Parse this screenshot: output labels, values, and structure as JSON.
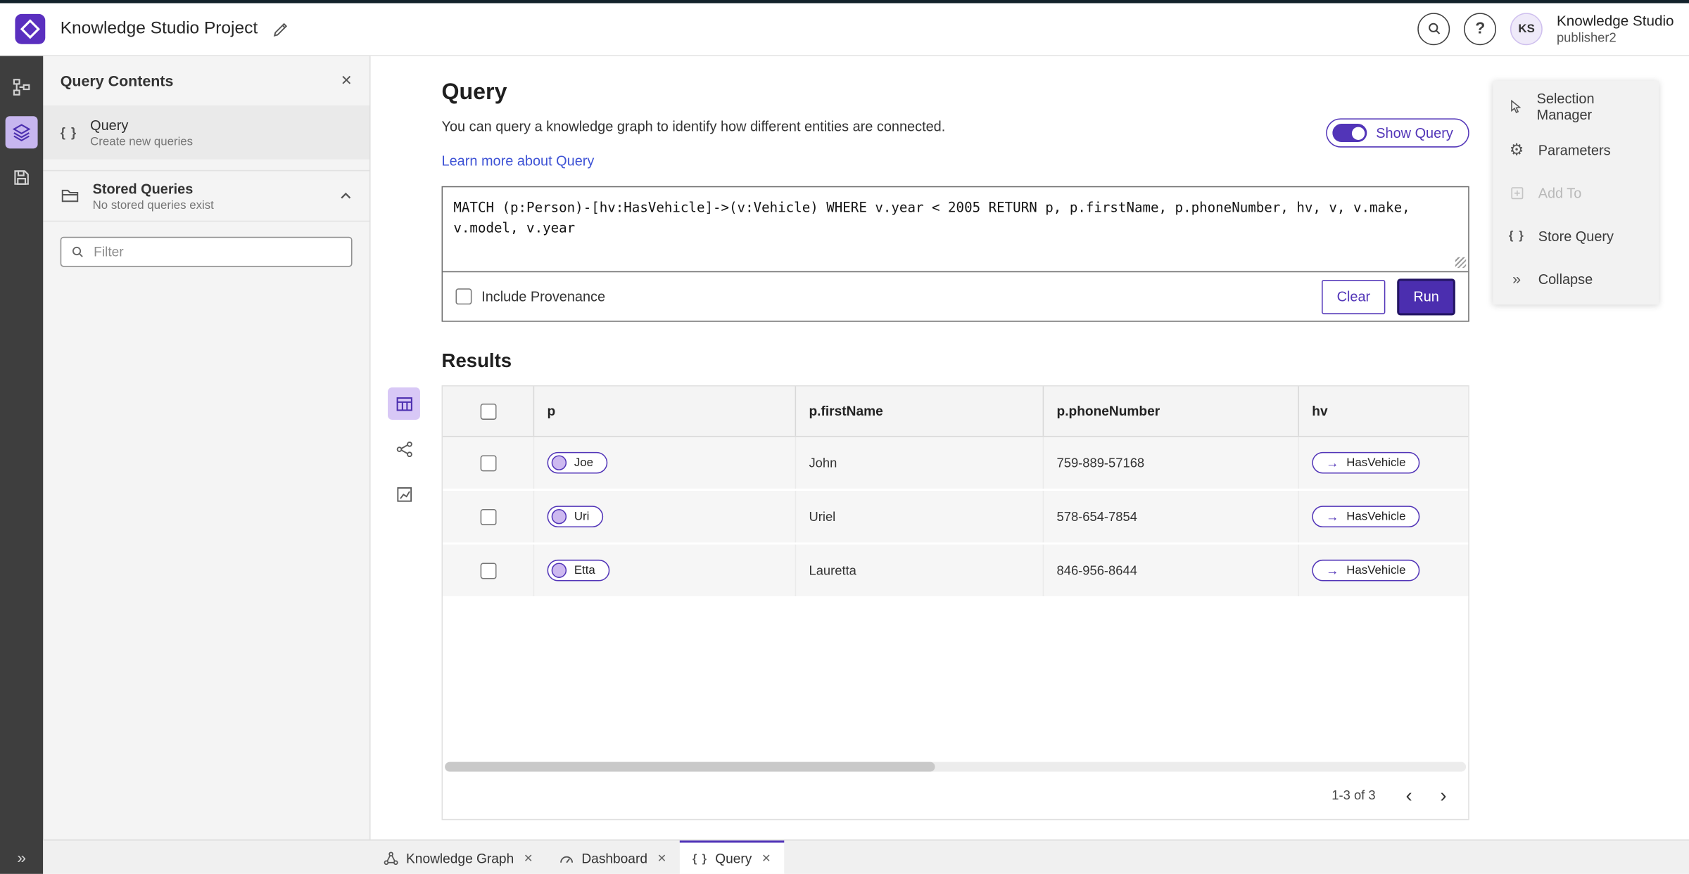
{
  "header": {
    "title": "Knowledge Studio Project",
    "user": {
      "initials": "KS",
      "name": "Knowledge Studio",
      "role": "publisher2"
    }
  },
  "left_panel": {
    "title": "Query Contents",
    "query_item": {
      "label": "Query",
      "description": "Create new queries"
    },
    "stored_queries": {
      "label": "Stored Queries",
      "description": "No stored queries exist"
    },
    "filter": {
      "placeholder": "Filter"
    }
  },
  "main": {
    "title": "Query",
    "description": "You can query a knowledge graph to identify how different entities are connected.",
    "learn_more_link": "Learn more about Query",
    "show_query_toggle": {
      "label": "Show Query",
      "state": "on"
    },
    "query_editor": {
      "text": "MATCH (p:Person)-[hv:HasVehicle]->(v:Vehicle) WHERE v.year < 2005 RETURN p, p.firstName, p.phoneNumber, hv, v, v.make, v.model, v.year"
    },
    "include_provenance": {
      "label": "Include Provenance",
      "checked": false
    },
    "buttons": {
      "clear": "Clear",
      "run": "Run"
    },
    "results_title": "Results"
  },
  "results_table": {
    "columns": [
      "p",
      "p.firstName",
      "p.phoneNumber",
      "hv"
    ],
    "rows": [
      {
        "p_node": "Joe",
        "firstName": "John",
        "phoneNumber": "759-889-57168",
        "hv_edge": "HasVehicle"
      },
      {
        "p_node": "Uri",
        "firstName": "Uriel",
        "phoneNumber": "578-654-7854",
        "hv_edge": "HasVehicle"
      },
      {
        "p_node": "Etta",
        "firstName": "Lauretta",
        "phoneNumber": "846-956-8644",
        "hv_edge": "HasVehicle"
      }
    ],
    "pagination": {
      "range_label": "1-3 of 3"
    }
  },
  "right_panel": {
    "items": [
      {
        "label": "Selection Manager",
        "disabled": false
      },
      {
        "label": "Parameters",
        "disabled": false
      },
      {
        "label": "Add To",
        "disabled": true
      },
      {
        "label": "Store Query",
        "disabled": false
      },
      {
        "label": "Collapse",
        "disabled": false
      }
    ]
  },
  "bottom_tabs": [
    {
      "label": "Knowledge Graph",
      "active": false
    },
    {
      "label": "Dashboard",
      "active": false
    },
    {
      "label": "Query",
      "active": true
    }
  ],
  "glyphs": {
    "braces": "{ }",
    "close": "✕",
    "double_chevron_right": "»",
    "arrow_right": "→",
    "question_mark": "?",
    "chevron_left": "‹",
    "chevron_right": "›",
    "gear": "⚙"
  },
  "colors": {
    "accent": "#5235b8",
    "accent_dark": "#4b2eaf",
    "link": "#3d52d5",
    "rail_bg": "#3e3e3e",
    "panel_bg": "#f4f4f4"
  }
}
